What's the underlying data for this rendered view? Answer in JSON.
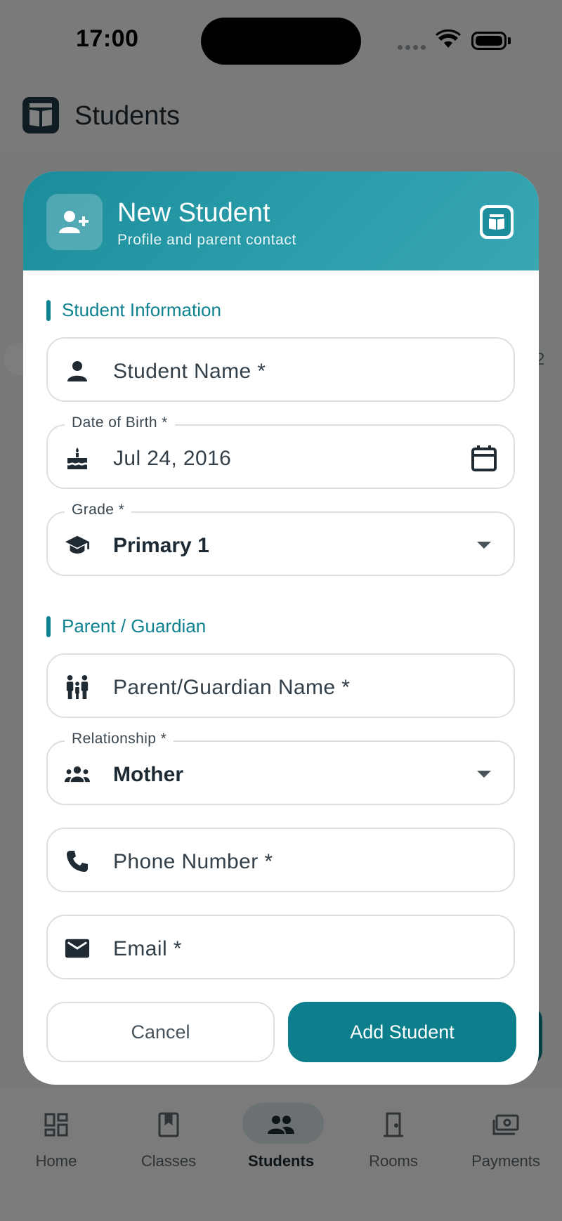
{
  "status_bar": {
    "time": "17:00"
  },
  "app_bar": {
    "title": "Students"
  },
  "background": {
    "partial_count": "2"
  },
  "bottom_nav": {
    "items": [
      {
        "label": "Home",
        "icon": "dashboard-icon",
        "active": false
      },
      {
        "label": "Classes",
        "icon": "book-icon",
        "active": false
      },
      {
        "label": "Students",
        "icon": "people-icon",
        "active": true
      },
      {
        "label": "Rooms",
        "icon": "door-icon",
        "active": false
      },
      {
        "label": "Payments",
        "icon": "payments-icon",
        "active": false
      }
    ]
  },
  "dialog": {
    "title": "New Student",
    "subtitle": "Profile and parent contact",
    "header_icon": "person-add-icon",
    "sections": {
      "student": "Student Information",
      "parent": "Parent / Guardian"
    },
    "fields": {
      "student_name": {
        "placeholder": "Student Name *",
        "value": "",
        "icon": "person-icon"
      },
      "dob": {
        "label": "Date of Birth *",
        "value": "Jul 24, 2016",
        "icon": "cake-icon",
        "trailing_icon": "calendar-icon"
      },
      "grade": {
        "label": "Grade *",
        "value": "Primary 1",
        "icon": "school-icon"
      },
      "parent_name": {
        "placeholder": "Parent/Guardian Name *",
        "value": "",
        "icon": "family-icon"
      },
      "relationship": {
        "label": "Relationship *",
        "value": "Mother",
        "icon": "groups-icon"
      },
      "phone": {
        "placeholder": "Phone Number *",
        "value": "",
        "icon": "phone-icon"
      },
      "email": {
        "placeholder": "Email *",
        "value": "",
        "icon": "mail-icon"
      }
    },
    "buttons": {
      "cancel": "Cancel",
      "submit": "Add Student"
    }
  },
  "colors": {
    "accent": "#0d7f8c",
    "header_gradient_start": "#1b8c9a",
    "header_gradient_end": "#3aa7b3",
    "scrim": "rgba(0,0,0,0.5)"
  }
}
